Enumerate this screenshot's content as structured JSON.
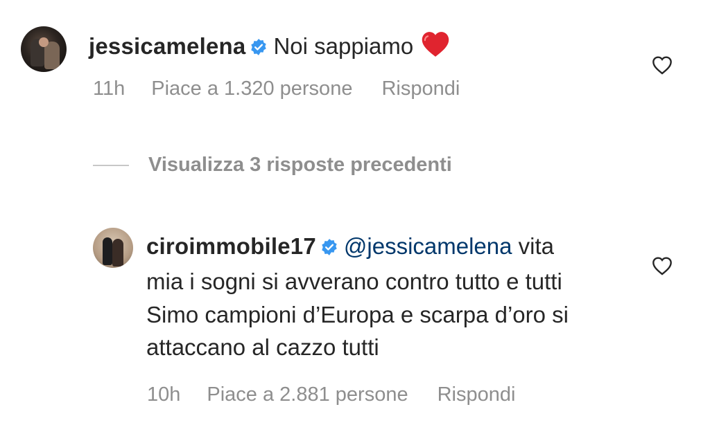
{
  "comments": [
    {
      "username": "jessicamelena",
      "verified": true,
      "text": "Noi sappiamo",
      "emoji": "red-heart",
      "time": "11h",
      "likes": "Piace a 1.320 persone",
      "reply": "Rispondi"
    },
    {
      "username": "ciroimmobile17",
      "verified": true,
      "mention": "@jessicamelena",
      "text_lines": [
        "vita",
        "mia i sogni si avverano contro tutto e tutti",
        "Simo campioni d’Europa e scarpa d’oro si",
        "attaccano al cazzo tutti"
      ],
      "time": "10h",
      "likes": "Piace a 2.881 persone",
      "reply": "Rispondi"
    }
  ],
  "view_replies": "Visualizza 3 risposte precedenti",
  "icons": {
    "verified": "verified-badge-icon",
    "like": "heart-outline-icon"
  },
  "colors": {
    "verified": "#3897f0",
    "mention": "#00376b",
    "meta": "#8e8e8e"
  }
}
